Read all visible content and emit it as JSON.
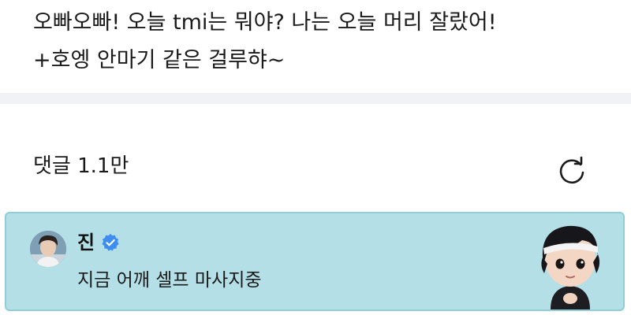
{
  "post": {
    "line1": "오빠오빠! 오늘 tmi는 뭐야? 나는 오늘 머리 잘랐어!",
    "line2": "+호엥 안마기 같은 걸루햐~"
  },
  "comments": {
    "header": "댓글 1.1만",
    "refresh_icon": "refresh-icon"
  },
  "pinned_comment": {
    "author": "진",
    "verified_icon": "verified-badge-icon",
    "text": "지금 어깨 셀프 마사지중",
    "avatar_icon": "profile-avatar",
    "sticker_icon": "character-sticker",
    "background_color": "#b5dfe6",
    "badge_color": "#3d8ef0"
  },
  "colors": {
    "divider": "#f1f2f5",
    "text": "#1a1a1a"
  }
}
